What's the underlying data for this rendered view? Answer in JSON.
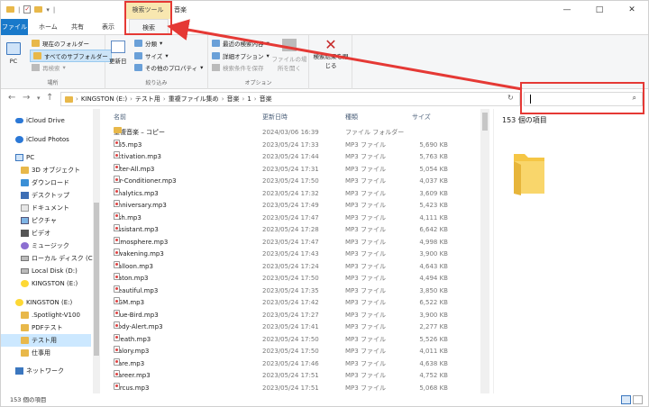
{
  "titlebar": {
    "title": "音楽",
    "tool_tab": "検索ツール",
    "window_controls": [
      "—",
      "□",
      "✕"
    ]
  },
  "ribbon_tabs": [
    {
      "label": "ファイル"
    },
    {
      "label": "ホーム"
    },
    {
      "label": "共有"
    },
    {
      "label": "表示"
    },
    {
      "label": "検索",
      "active": true
    }
  ],
  "ribbon": {
    "location": {
      "label": "場所",
      "pc": "PC",
      "current_folder": "現在のフォルダー",
      "all_subfolders": "すべてのサブフォルダー",
      "search_again": "再検索"
    },
    "refine": {
      "label": "絞り込み",
      "date_modified": "更新日",
      "kind": "分類",
      "size": "サイズ",
      "other_props": "その他のプロパティ"
    },
    "options": {
      "label": "オプション",
      "recent_searches": "最近の検索内容",
      "advanced": "詳細オプション",
      "save_search": "検索条件を保存",
      "open_location": "ファイルの場所を開く"
    },
    "close": {
      "label": "検索結果を閉じる"
    }
  },
  "address": {
    "crumbs": [
      "KINGSTON (E:)",
      "テスト用",
      "重複ファイル集め",
      "音楽",
      "1",
      "音楽"
    ],
    "search_placeholder": ""
  },
  "nav_pane": [
    {
      "label": "iCloud Drive",
      "icon": "cloud-icon"
    },
    {
      "label": "iCloud Photos",
      "icon": "photos-icon"
    },
    {
      "label": "PC",
      "icon": "pc-icon"
    },
    {
      "label": "3D オブジェクト",
      "icon": "folder-icon"
    },
    {
      "label": "ダウンロード",
      "icon": "download-icon"
    },
    {
      "label": "デスクトップ",
      "icon": "desktop-icon"
    },
    {
      "label": "ドキュメント",
      "icon": "document-icon"
    },
    {
      "label": "ピクチャ",
      "icon": "picture-icon"
    },
    {
      "label": "ビデオ",
      "icon": "video-icon"
    },
    {
      "label": "ミュージック",
      "icon": "music-icon"
    },
    {
      "label": "ローカル ディスク (C:)",
      "icon": "drive-icon"
    },
    {
      "label": "Local Disk (D:)",
      "icon": "drive-icon"
    },
    {
      "label": "KINGSTON (E:)",
      "icon": "usb-icon"
    },
    {
      "label": "KINGSTON (E:)",
      "icon": "usb-icon"
    },
    {
      "label": ".Spotlight-V100",
      "icon": "folder-icon"
    },
    {
      "label": "PDFテスト",
      "icon": "folder-icon"
    },
    {
      "label": "テスト用",
      "icon": "folder-icon",
      "selected": true
    },
    {
      "label": "仕事用",
      "icon": "folder-icon"
    },
    {
      "label": "ネットワーク",
      "icon": "network-icon"
    }
  ],
  "columns": {
    "name": "名前",
    "date": "更新日時",
    "type": "種類",
    "size": "サイズ"
  },
  "files": [
    {
      "name": "重複音楽 – コピー",
      "date": "2024/03/06 16:39",
      "type": "ファイル フォルダー",
      "size": "",
      "folder": true
    },
    {
      "name": "365.mp3",
      "date": "2023/05/24 17:33",
      "type": "MP3 ファイル",
      "size": "5,690 KB"
    },
    {
      "name": "Activation.mp3",
      "date": "2023/05/24 17:44",
      "type": "MP3 ファイル",
      "size": "5,763 KB"
    },
    {
      "name": "After-All.mp3",
      "date": "2023/05/24 17:31",
      "type": "MP3 ファイル",
      "size": "5,054 KB"
    },
    {
      "name": "Air-Conditioner.mp3",
      "date": "2023/05/24 17:50",
      "type": "MP3 ファイル",
      "size": "4,037 KB"
    },
    {
      "name": "Analytics.mp3",
      "date": "2023/05/24 17:32",
      "type": "MP3 ファイル",
      "size": "3,609 KB"
    },
    {
      "name": "Anniversary.mp3",
      "date": "2023/05/24 17:49",
      "type": "MP3 ファイル",
      "size": "5,423 KB"
    },
    {
      "name": "Ash.mp3",
      "date": "2023/05/24 17:47",
      "type": "MP3 ファイル",
      "size": "4,111 KB"
    },
    {
      "name": "Assistant.mp3",
      "date": "2023/05/24 17:28",
      "type": "MP3 ファイル",
      "size": "6,642 KB"
    },
    {
      "name": "Atmosphere.mp3",
      "date": "2023/05/24 17:47",
      "type": "MP3 ファイル",
      "size": "4,998 KB"
    },
    {
      "name": "Awakening.mp3",
      "date": "2023/05/24 17:43",
      "type": "MP3 ファイル",
      "size": "3,900 KB"
    },
    {
      "name": "Balloon.mp3",
      "date": "2023/05/24 17:24",
      "type": "MP3 ファイル",
      "size": "4,643 KB"
    },
    {
      "name": "Baton.mp3",
      "date": "2023/05/24 17:50",
      "type": "MP3 ファイル",
      "size": "4,494 KB"
    },
    {
      "name": "Beautiful.mp3",
      "date": "2023/05/24 17:35",
      "type": "MP3 ファイル",
      "size": "3,850 KB"
    },
    {
      "name": "BGM.mp3",
      "date": "2023/05/24 17:42",
      "type": "MP3 ファイル",
      "size": "6,522 KB"
    },
    {
      "name": "Blue-Bird.mp3",
      "date": "2023/05/24 17:27",
      "type": "MP3 ファイル",
      "size": "3,900 KB"
    },
    {
      "name": "Body-Alert.mp3",
      "date": "2023/05/24 17:41",
      "type": "MP3 ファイル",
      "size": "2,277 KB"
    },
    {
      "name": "Breath.mp3",
      "date": "2023/05/24 17:50",
      "type": "MP3 ファイル",
      "size": "5,526 KB"
    },
    {
      "name": "Calory.mp3",
      "date": "2023/05/24 17:50",
      "type": "MP3 ファイル",
      "size": "4,011 KB"
    },
    {
      "name": "Care.mp3",
      "date": "2023/05/24 17:46",
      "type": "MP3 ファイル",
      "size": "4,638 KB"
    },
    {
      "name": "Career.mp3",
      "date": "2023/05/24 17:51",
      "type": "MP3 ファイル",
      "size": "4,752 KB"
    },
    {
      "name": "Circus.mp3",
      "date": "2023/05/24 17:51",
      "type": "MP3 ファイル",
      "size": "5,068 KB"
    }
  ],
  "preview": {
    "count": "153 個の項目"
  },
  "status": {
    "text": "153 個の項目"
  },
  "colors": {
    "accent": "#1979ca",
    "highlight": "#e53935",
    "tool_tab": "#f8e7b0"
  }
}
